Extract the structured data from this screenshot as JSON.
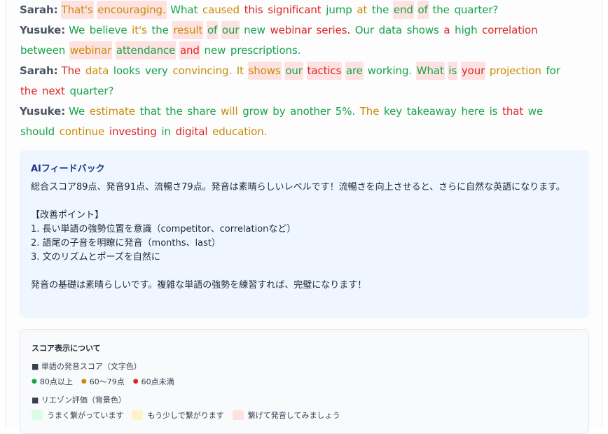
{
  "transcript": [
    {
      "speaker": "Sarah:",
      "words": [
        {
          "t": "That's",
          "c": "o",
          "b": "r"
        },
        {
          "t": "encouraging.",
          "c": "o",
          "b": "r"
        },
        {
          "t": "What",
          "c": "g",
          "b": ""
        },
        {
          "t": "caused",
          "c": "o",
          "b": ""
        },
        {
          "t": "this",
          "c": "r",
          "b": ""
        },
        {
          "t": "significant",
          "c": "r",
          "b": ""
        },
        {
          "t": "jump",
          "c": "g",
          "b": ""
        },
        {
          "t": "at",
          "c": "o",
          "b": ""
        },
        {
          "t": "the",
          "c": "g",
          "b": ""
        },
        {
          "t": "end",
          "c": "g",
          "b": "r"
        },
        {
          "t": "of",
          "c": "g",
          "b": "r"
        },
        {
          "t": "the",
          "c": "g",
          "b": ""
        },
        {
          "t": "quarter?",
          "c": "g",
          "b": ""
        }
      ]
    },
    {
      "speaker": "Yusuke:",
      "words": [
        {
          "t": "We",
          "c": "g",
          "b": ""
        },
        {
          "t": "believe",
          "c": "g",
          "b": ""
        },
        {
          "t": "it's",
          "c": "o",
          "b": ""
        },
        {
          "t": "the",
          "c": "g",
          "b": ""
        },
        {
          "t": "result",
          "c": "o",
          "b": "r"
        },
        {
          "t": "of",
          "c": "g",
          "b": "r"
        },
        {
          "t": "our",
          "c": "g",
          "b": "r"
        },
        {
          "t": "new",
          "c": "g",
          "b": ""
        },
        {
          "t": "webinar",
          "c": "r",
          "b": ""
        },
        {
          "t": "series.",
          "c": "r",
          "b": ""
        },
        {
          "t": "Our",
          "c": "g",
          "b": ""
        },
        {
          "t": "data",
          "c": "g",
          "b": ""
        },
        {
          "t": "shows",
          "c": "g",
          "b": ""
        },
        {
          "t": "a",
          "c": "r",
          "b": ""
        },
        {
          "t": "high",
          "c": "g",
          "b": ""
        },
        {
          "t": "correlation",
          "c": "r",
          "b": ""
        },
        {
          "t": "between",
          "c": "g",
          "b": ""
        },
        {
          "t": "webinar",
          "c": "o",
          "b": "r"
        },
        {
          "t": "attendance",
          "c": "g",
          "b": "r"
        },
        {
          "t": "and",
          "c": "r",
          "b": "r"
        },
        {
          "t": "new",
          "c": "g",
          "b": ""
        },
        {
          "t": "prescriptions.",
          "c": "g",
          "b": ""
        }
      ]
    },
    {
      "speaker": "Sarah:",
      "words": [
        {
          "t": "The",
          "c": "r",
          "b": ""
        },
        {
          "t": "data",
          "c": "o",
          "b": ""
        },
        {
          "t": "looks",
          "c": "g",
          "b": ""
        },
        {
          "t": "very",
          "c": "g",
          "b": ""
        },
        {
          "t": "convincing.",
          "c": "o",
          "b": ""
        },
        {
          "t": "It",
          "c": "o",
          "b": ""
        },
        {
          "t": "shows",
          "c": "o",
          "b": "r"
        },
        {
          "t": "our",
          "c": "g",
          "b": "r"
        },
        {
          "t": "tactics",
          "c": "r",
          "b": "r"
        },
        {
          "t": "are",
          "c": "g",
          "b": "r"
        },
        {
          "t": "working.",
          "c": "g",
          "b": ""
        },
        {
          "t": "What",
          "c": "g",
          "b": "r"
        },
        {
          "t": "is",
          "c": "g",
          "b": "r"
        },
        {
          "t": "your",
          "c": "r",
          "b": "r"
        },
        {
          "t": "projection",
          "c": "o",
          "b": ""
        },
        {
          "t": "for",
          "c": "g",
          "b": ""
        },
        {
          "t": "the",
          "c": "r",
          "b": ""
        },
        {
          "t": "next",
          "c": "r",
          "b": ""
        },
        {
          "t": "quarter?",
          "c": "g",
          "b": ""
        }
      ]
    },
    {
      "speaker": "Yusuke:",
      "words": [
        {
          "t": "We",
          "c": "g",
          "b": ""
        },
        {
          "t": "estimate",
          "c": "o",
          "b": ""
        },
        {
          "t": "that",
          "c": "g",
          "b": ""
        },
        {
          "t": "the",
          "c": "g",
          "b": ""
        },
        {
          "t": "share",
          "c": "g",
          "b": ""
        },
        {
          "t": "will",
          "c": "o",
          "b": ""
        },
        {
          "t": "grow",
          "c": "g",
          "b": ""
        },
        {
          "t": "by",
          "c": "g",
          "b": ""
        },
        {
          "t": "another",
          "c": "g",
          "b": ""
        },
        {
          "t": "5%.",
          "c": "g",
          "b": ""
        },
        {
          "t": "The",
          "c": "o",
          "b": ""
        },
        {
          "t": "key",
          "c": "g",
          "b": ""
        },
        {
          "t": "takeaway",
          "c": "g",
          "b": ""
        },
        {
          "t": "here",
          "c": "g",
          "b": ""
        },
        {
          "t": "is",
          "c": "g",
          "b": ""
        },
        {
          "t": "that",
          "c": "r",
          "b": ""
        },
        {
          "t": "we",
          "c": "g",
          "b": ""
        },
        {
          "t": "should",
          "c": "g",
          "b": ""
        },
        {
          "t": "continue",
          "c": "o",
          "b": ""
        },
        {
          "t": "investing",
          "c": "r",
          "b": ""
        },
        {
          "t": "in",
          "c": "g",
          "b": ""
        },
        {
          "t": "digital",
          "c": "r",
          "b": ""
        },
        {
          "t": "education.",
          "c": "o",
          "b": ""
        }
      ]
    }
  ],
  "feedback": {
    "title": "AIフィードバック",
    "lines": [
      "総合スコア89点、発音91点、流暢さ79点。発音は素晴らしいレベルです！流暢さを向上させると、さらに自然な英語になります。",
      "",
      "【改善ポイント】",
      "1. 長い単語の強勢位置を意識（competitor、correlationなど）",
      "2. 語尾の子音を明瞭に発音（months、last）",
      "3. 文のリズムとポーズを自然に",
      "",
      "発音の基礎は素晴らしいです。複雑な単語の強勢を練習すれば、完璧になります！"
    ]
  },
  "legend": {
    "title": "スコア表示について",
    "word_heading": "■ 単語の発音スコア（文字色）",
    "word_items": [
      {
        "label": "80点以上",
        "color": "#16a34a"
      },
      {
        "label": "60〜79点",
        "color": "#ca8a04"
      },
      {
        "label": "60点未満",
        "color": "#dc2626"
      }
    ],
    "liaison_heading": "■ リエゾン評価（背景色）",
    "liaison_items": [
      {
        "label": "うまく繋がっています",
        "color": "#dcfce7"
      },
      {
        "label": "もう少しで繋がります",
        "color": "#fef3c7"
      },
      {
        "label": "繋げて発音してみましょう",
        "color": "#fee2e2"
      }
    ]
  }
}
